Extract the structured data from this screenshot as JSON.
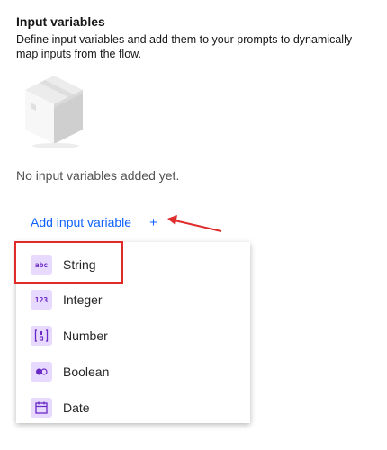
{
  "section": {
    "title": "Input variables",
    "description": "Define input variables and add them to your prompts to dynamically map inputs from the flow."
  },
  "empty_state": {
    "illustration": "box-illustration",
    "message": "No input variables added yet."
  },
  "add_action": {
    "label": "Add input variable",
    "plus": "+"
  },
  "menu": {
    "items": [
      {
        "icon": "string-icon",
        "icon_text": "abc",
        "label": "String"
      },
      {
        "icon": "integer-icon",
        "icon_text": "123",
        "label": "Integer"
      },
      {
        "icon": "number-icon",
        "label": "Number"
      },
      {
        "icon": "boolean-icon",
        "label": "Boolean"
      },
      {
        "icon": "date-icon",
        "label": "Date"
      }
    ]
  },
  "colors": {
    "link": "#0f62fe",
    "icon_bg": "#e8daff",
    "icon_fg": "#6929c4",
    "annotation": "#e02b2b"
  }
}
